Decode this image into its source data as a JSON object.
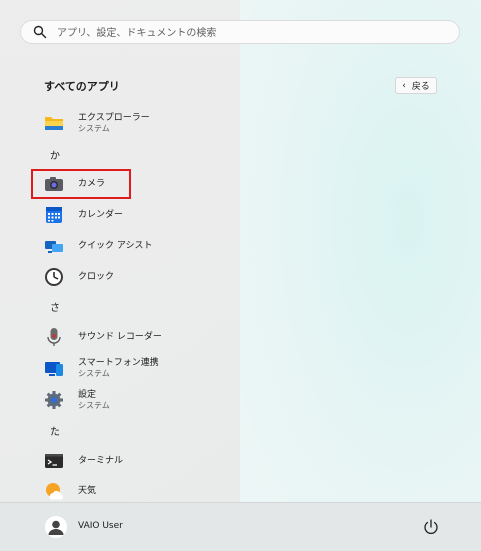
{
  "search": {
    "placeholder": "アプリ、設定、ドキュメントの検索"
  },
  "all_apps": {
    "heading": "すべてのアプリ",
    "back_label": "戻る"
  },
  "sections": [
    {
      "letter": "か"
    },
    {
      "letter": "さ"
    },
    {
      "letter": "た"
    }
  ],
  "apps": [
    {
      "name": "エクスプローラー",
      "sub": "システム",
      "icon": "folder-icon"
    },
    {
      "name": "カメラ",
      "sub": "",
      "icon": "camera-icon"
    },
    {
      "name": "カレンダー",
      "sub": "",
      "icon": "calendar-icon"
    },
    {
      "name": "クイック アシスト",
      "sub": "",
      "icon": "quick-assist-icon"
    },
    {
      "name": "クロック",
      "sub": "",
      "icon": "clock-icon"
    },
    {
      "name": "サウンド レコーダー",
      "sub": "",
      "icon": "microphone-icon"
    },
    {
      "name": "スマートフォン連携",
      "sub": "システム",
      "icon": "phone-link-icon"
    },
    {
      "name": "設定",
      "sub": "システム",
      "icon": "gear-icon"
    },
    {
      "name": "ターミナル",
      "sub": "",
      "icon": "terminal-icon"
    },
    {
      "name": "天気",
      "sub": "",
      "icon": "weather-icon"
    }
  ],
  "user": {
    "name": "VAIO User"
  },
  "colors": {
    "highlight": "#e01b1b",
    "accent": "#0067c0"
  }
}
